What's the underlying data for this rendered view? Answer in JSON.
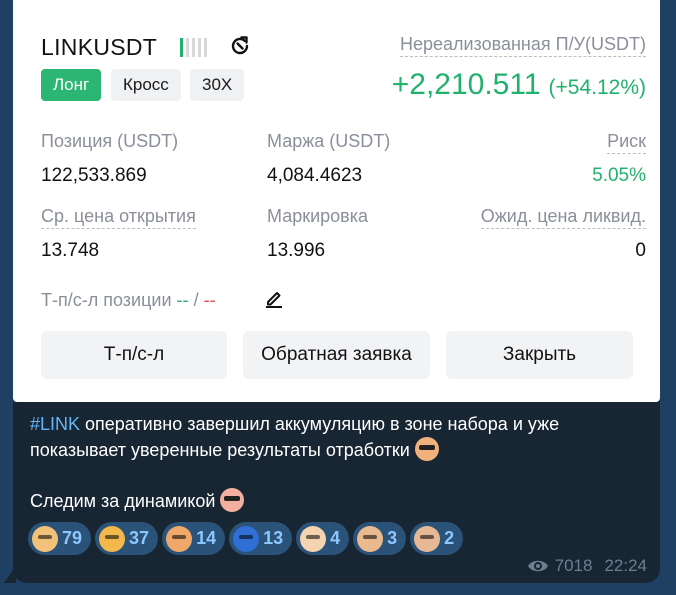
{
  "position": {
    "symbol": "LINKUSDT",
    "signal_bars_filled": 1,
    "signal_bars_total": 5,
    "unrealized_label": "Нереализованная П/У(USDT)",
    "tags": {
      "side": "Лонг",
      "margin_mode": "Кросс",
      "leverage": "30X"
    },
    "pnl_value": "+2,210.511",
    "pnl_percent": "(+54.12%)",
    "fields": {
      "position_label": "Позиция (USDT)",
      "position_value": "122,533.869",
      "margin_label": "Маржа (USDT)",
      "margin_value": "4,084.4623",
      "risk_label": "Риск",
      "risk_value": "5.05%",
      "entry_label": "Ср. цена открытия",
      "entry_value": "13.748",
      "mark_label": "Маркировка",
      "mark_value": "13.996",
      "liq_label": "Ожид. цена ликвид.",
      "liq_value": "0"
    },
    "tpsl": {
      "label": "Т-п/с-л позиции",
      "tp": "--",
      "separator": "/",
      "sl": "--"
    },
    "buttons": {
      "tpsl": "Т-п/с-л",
      "reverse": "Обратная заявка",
      "close": "Закрыть"
    }
  },
  "message": {
    "hashtag": "#LINK",
    "text1": " оперативно завершил аккумуляцию в зоне набора и уже показывает уверенные результаты отработки",
    "text2": "Следим за динамикой"
  },
  "reactions": [
    {
      "count": "79",
      "color": "#f3c27a"
    },
    {
      "count": "37",
      "color": "#f2b84b"
    },
    {
      "count": "14",
      "color": "#f0a86a"
    },
    {
      "count": "13",
      "color": "#2f6fd6"
    },
    {
      "count": "4",
      "color": "#f4d3b0"
    },
    {
      "count": "3",
      "color": "#e9b98f"
    },
    {
      "count": "2",
      "color": "#e7b896"
    }
  ],
  "views": "7018",
  "time": "22:24",
  "icons": {
    "refresh": "refresh-icon",
    "edit": "pencil-icon",
    "views": "eye-icon"
  }
}
